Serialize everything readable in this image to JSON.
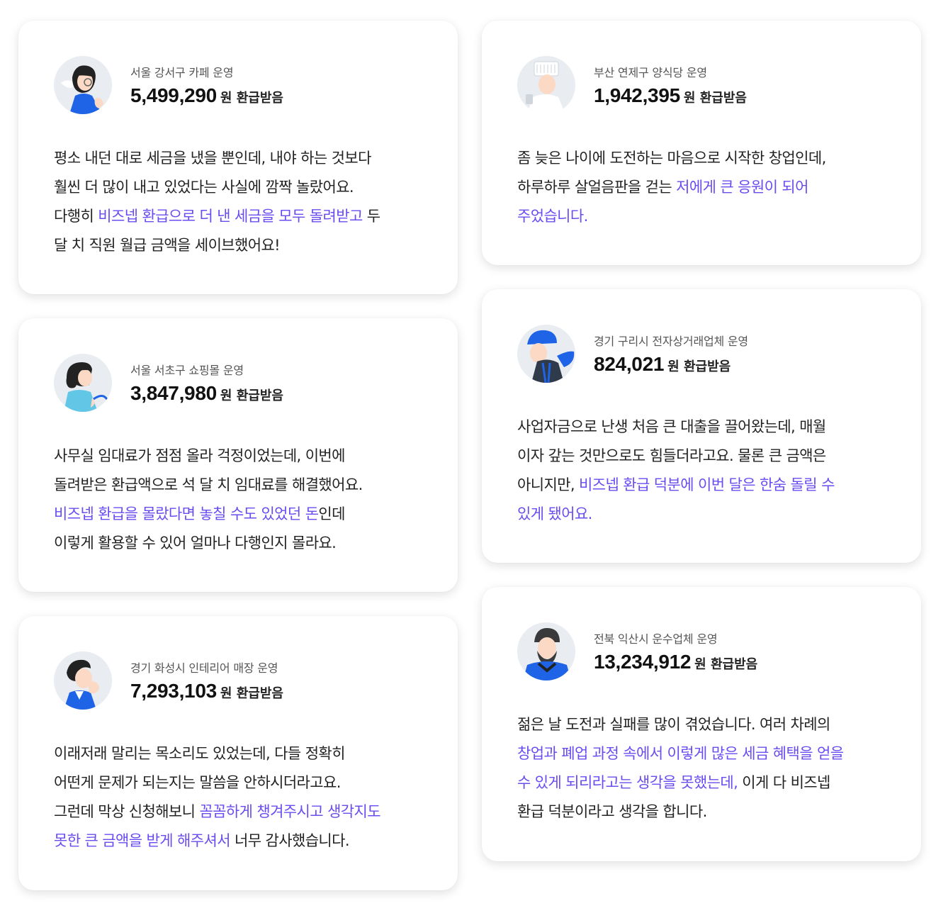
{
  "unit_label": "원 환급받음",
  "colors": {
    "highlight": "#6a4cf0",
    "brand_blue": "#1f63e6"
  },
  "reviews": [
    {
      "avatar_icon": "cafe-owner-avatar-icon",
      "location": "서울 강서구 카페 운영",
      "amount": "5,499,290",
      "lines": [
        [
          {
            "t": "평소 내던 대로 세금을 냈을 뿐인데, 내야 하는 것보다"
          }
        ],
        [
          {
            "t": "훨씬 더 많이 내고 있었다는 사실에 깜짝 놀랐어요."
          }
        ],
        [
          {
            "t": "다행히 "
          },
          {
            "t": "비즈넵 환급으로 더 낸 세금을 모두 돌려받고",
            "hl": true
          },
          {
            "t": " 두"
          }
        ],
        [
          {
            "t": "달 치 직원 월급 금액을 세이브했어요!"
          }
        ]
      ]
    },
    {
      "avatar_icon": "chef-avatar-icon",
      "location": "부산 연제구 양식당 운영",
      "amount": "1,942,395",
      "lines": [
        [
          {
            "t": "좀 늦은 나이에 도전하는 마음으로 시작한 창업인데,"
          }
        ],
        [
          {
            "t": "하루하루 살얼음판을 걷는 "
          },
          {
            "t": "저에게 큰 응원이 되어",
            "hl": true
          }
        ],
        [
          {
            "t": "주었습니다.",
            "hl": true
          }
        ]
      ]
    },
    {
      "avatar_icon": "shop-owner-avatar-icon",
      "location": "서울 서초구 쇼핑몰 운영",
      "amount": "3,847,980",
      "lines": [
        [
          {
            "t": "사무실 임대료가 점점 올라 걱정이었는데, 이번에"
          }
        ],
        [
          {
            "t": "돌려받은 환급액으로 석 달 치 임대료를 해결했어요."
          }
        ],
        [
          {
            "t": "비즈넵 환급을 몰랐다면 놓칠 수도 있었던 돈",
            "hl": true
          },
          {
            "t": "인데"
          }
        ],
        [
          {
            "t": "이렇게 활용할 수 있어 얼마나 다행인지 몰라요."
          }
        ]
      ]
    },
    {
      "avatar_icon": "courier-avatar-icon",
      "location": "경기 구리시 전자상거래업체 운영",
      "amount": "824,021",
      "lines": [
        [
          {
            "t": "사업자금으로 난생 처음 큰 대출을 끌어왔는데, 매월"
          }
        ],
        [
          {
            "t": "이자 갚는 것만으로도 힘들더라고요. 물론 큰 금액은"
          }
        ],
        [
          {
            "t": "아니지만, "
          },
          {
            "t": "비즈넵 환급 덕분에 이번 달은 한숨 돌릴 수",
            "hl": true
          }
        ],
        [
          {
            "t": "있게 됐어요.",
            "hl": true
          }
        ]
      ]
    },
    {
      "avatar_icon": "interior-owner-avatar-icon",
      "location": "경기 화성시 인테리어 매장 운영",
      "amount": "7,293,103",
      "lines": [
        [
          {
            "t": "이래저래 말리는 목소리도 있었는데, 다들 정확히"
          }
        ],
        [
          {
            "t": "어떤게 문제가 되는지는 말씀을 안하시더라고요."
          }
        ],
        [
          {
            "t": "그런데 막상 신청해보니 "
          },
          {
            "t": "꼼꼼하게 챙겨주시고 생각지도",
            "hl": true
          }
        ],
        [
          {
            "t": "못한 큰 금액을 받게 해주셔서",
            "hl": true
          },
          {
            "t": " 너무 감사했습니다."
          }
        ]
      ]
    },
    {
      "avatar_icon": "bearded-man-avatar-icon",
      "location": "전북 익산시 운수업체 운영",
      "amount": "13,234,912",
      "lines": [
        [
          {
            "t": "젊은 날 도전과 실패를 많이 겪었습니다. 여러 차례의"
          }
        ],
        [
          {
            "t": "창업과 폐업 과정 속에서 이렇게 많은 세금 혜택을 얻을",
            "hl": true
          }
        ],
        [
          {
            "t": "수 있게 되리라고는 생각을 못했는데,",
            "hl": true
          },
          {
            "t": " 이게 다 비즈넵"
          }
        ],
        [
          {
            "t": "환급 덕분이라고 생각을 합니다."
          }
        ]
      ]
    }
  ]
}
